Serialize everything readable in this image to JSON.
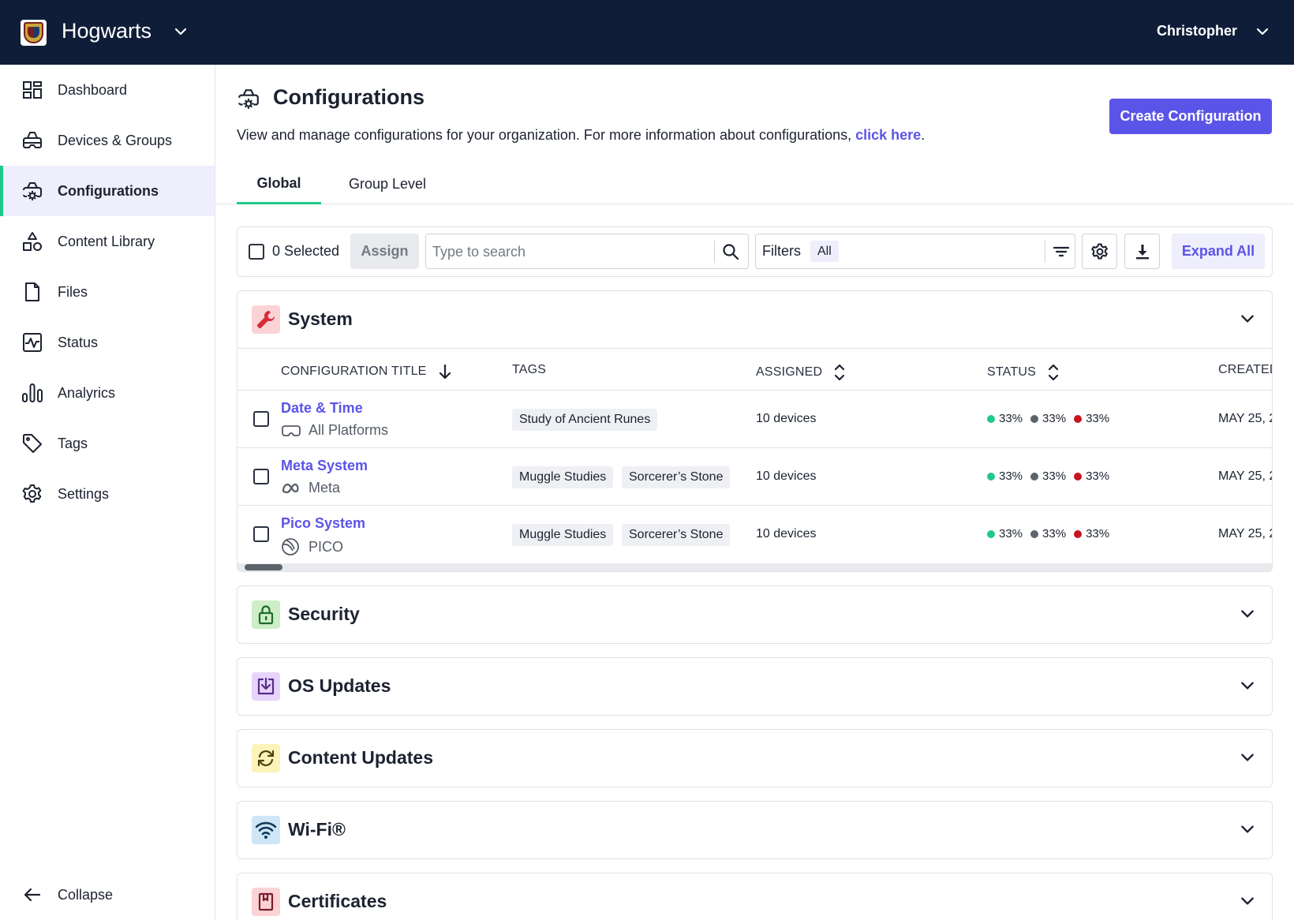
{
  "topbar": {
    "org_name": "Hogwarts",
    "user_name": "Christopher"
  },
  "sidebar": {
    "items": [
      {
        "label": "Dashboard",
        "icon": "dashboard-icon"
      },
      {
        "label": "Devices & Groups",
        "icon": "headset-icon"
      },
      {
        "label": "Configurations",
        "icon": "configurations-icon",
        "active": true
      },
      {
        "label": "Content Library",
        "icon": "shapes-icon"
      },
      {
        "label": "Files",
        "icon": "file-icon"
      },
      {
        "label": "Status",
        "icon": "pulse-icon"
      },
      {
        "label": "Analyrics",
        "icon": "bar-chart-icon"
      },
      {
        "label": "Tags",
        "icon": "tag-icon"
      },
      {
        "label": "Settings",
        "icon": "gear-icon"
      }
    ],
    "collapse_label": "Collapse"
  },
  "page": {
    "title": "Configurations",
    "description": "View and manage configurations for your organization. For more information about configurations, ",
    "link_text": "click here",
    "description_end": ".",
    "create_button": "Create Configuration"
  },
  "tabs": [
    {
      "label": "Global",
      "active": true
    },
    {
      "label": "Group Level",
      "active": false
    }
  ],
  "toolbar": {
    "selected_label": "0 Selected",
    "assign_label": "Assign",
    "search_placeholder": "Type to search",
    "filters_label": "Filters",
    "filter_value": "All",
    "expand_label": "Expand All"
  },
  "sections": [
    {
      "title": "System",
      "icon": "wrench-icon",
      "icon_bg": "#fbd3d6",
      "icon_color": "#d62b3a",
      "expanded": true
    },
    {
      "title": "Security",
      "icon": "lock-icon",
      "icon_bg": "#cdeec6",
      "icon_color": "#1f6b2b"
    },
    {
      "title": "OS Updates",
      "icon": "download-box-icon",
      "icon_bg": "#e6d4fb",
      "icon_color": "#5a2b8c"
    },
    {
      "title": "Content Updates",
      "icon": "refresh-icon",
      "icon_bg": "#fbf3b8",
      "icon_color": "#4a4310"
    },
    {
      "title": "Wi-Fi®",
      "icon": "wifi-icon",
      "icon_bg": "#cfe6f7",
      "icon_color": "#123a5a"
    },
    {
      "title": "Certificates",
      "icon": "certificate-icon",
      "icon_bg": "#fbd3d6",
      "icon_color": "#7a1f2a"
    }
  ],
  "table": {
    "headers": {
      "title": "CONFIGURATION TITLE",
      "tags": "TAGS",
      "assigned": "ASSIGNED",
      "status": "STATUS",
      "created": "CREATED"
    },
    "rows": [
      {
        "title": "Date & Time",
        "platform": "All Platforms",
        "platform_icon": "headset-outline-icon",
        "tags": [
          "Study of Ancient Runes"
        ],
        "assigned": "10 devices",
        "status": [
          "33%",
          "33%",
          "33%"
        ],
        "created": "MAY 25, 2"
      },
      {
        "title": "Meta System",
        "platform": "Meta",
        "platform_icon": "meta-logo-icon",
        "tags": [
          "Muggle Studies",
          "Sorcerer’s Stone"
        ],
        "assigned": "10 devices",
        "status": [
          "33%",
          "33%",
          "33%"
        ],
        "created": "MAY 25, 2"
      },
      {
        "title": "Pico System",
        "platform": "PICO",
        "platform_icon": "pico-logo-icon",
        "tags": [
          "Muggle Studies",
          "Sorcerer’s Stone"
        ],
        "assigned": "10 devices",
        "status": [
          "33%",
          "33%",
          "33%"
        ],
        "created": "MAY 25, 2"
      }
    ],
    "status_colors": [
      "#1fc98a",
      "#5d636d",
      "#c8141e"
    ]
  }
}
